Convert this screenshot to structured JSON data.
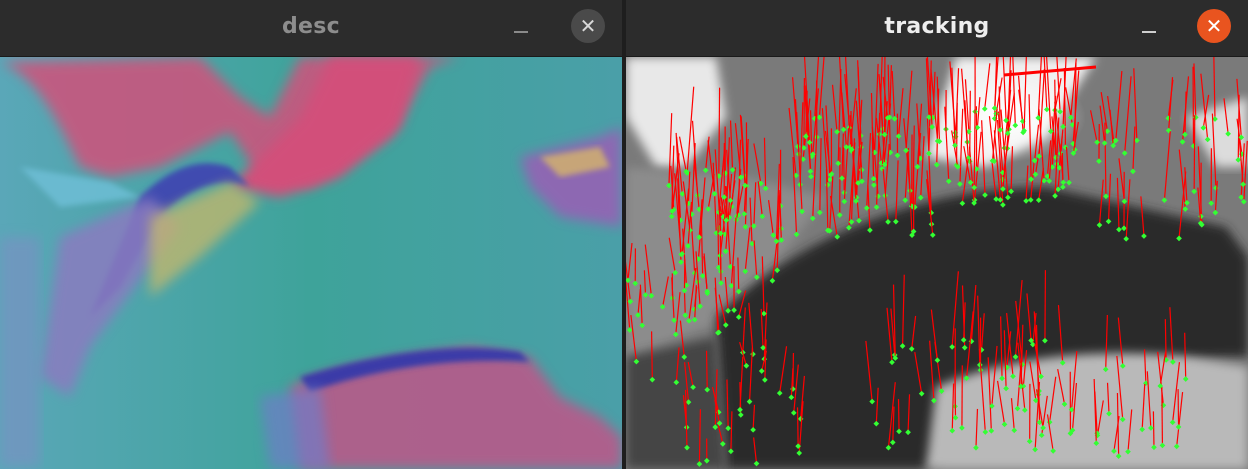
{
  "windows": {
    "desc": {
      "title": "desc",
      "minimize_glyph": "–",
      "close_glyph": "✕",
      "close_color": "#4a4a4a"
    },
    "tracking": {
      "title": "tracking",
      "minimize_glyph": "–",
      "close_glyph": "✕",
      "close_color": "#e9541f"
    }
  },
  "overlay_colors": {
    "tracks": "#ff0000",
    "keypoints": "#33ff33"
  },
  "icons": [
    "minimize-icon",
    "close-icon"
  ]
}
